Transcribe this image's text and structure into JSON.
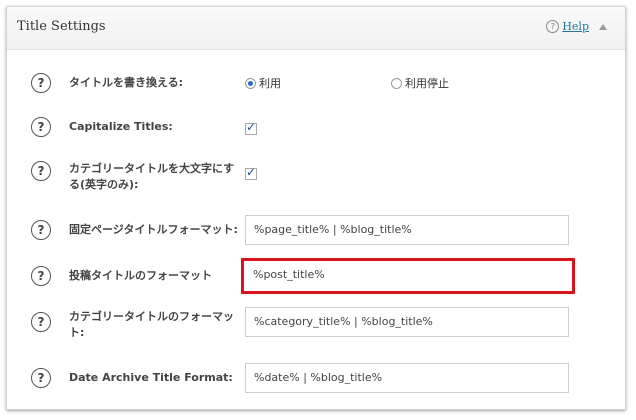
{
  "panel": {
    "title": "Title Settings",
    "help_icon": "question-icon",
    "help_label": "Help",
    "collapse_icon": "triangle-up-icon"
  },
  "icon_glyph": "?",
  "settings": {
    "rewrite_titles": {
      "label": "タイトルを書き換える:",
      "options": [
        "利用",
        "利用停止"
      ],
      "selected": "利用"
    },
    "capitalize_titles": {
      "label": "Capitalize Titles:",
      "checked": true
    },
    "capitalize_category": {
      "label_line1": "カテゴリータイトルを大文字にす",
      "label_line2": "る(英字のみ):",
      "checked": true
    },
    "page_title_format": {
      "label": "固定ページタイトルフォーマット:",
      "value": "%page_title% | %blog_title%"
    },
    "post_title_format": {
      "label": "投稿タイトルのフォーマット",
      "value": "%post_title%"
    },
    "category_title_format": {
      "label_line1": "カテゴリータイトルのフォーマッ",
      "label_line2": "ト:",
      "value": "%category_title% | %blog_title%"
    },
    "date_archive_title_format": {
      "label": "Date Archive Title Format:",
      "value": "%date% | %blog_title%"
    }
  },
  "colors": {
    "highlight": "#d9131c",
    "link": "#21759b",
    "radio_dot": "#1e6dbf"
  }
}
